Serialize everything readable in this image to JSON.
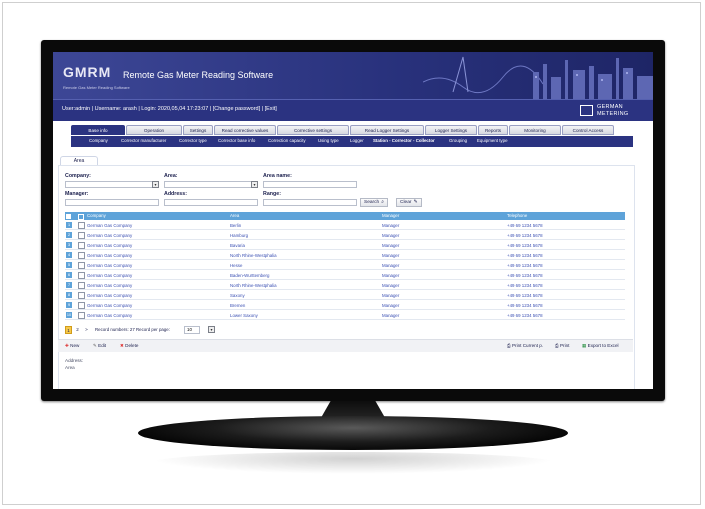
{
  "app": {
    "logo_text": "GMRM",
    "logo_subtitle": "Remote Gas Meter Reading Software",
    "title": "Remote Gas Meter Reading Software"
  },
  "userbar": {
    "text": "User:admin  |  Username: arash  |  Login: 2020,05,04  17:23:07  |  [Change password]  |  [Exit]",
    "brand_line1": "GERMAN",
    "brand_line2": "METERING"
  },
  "nav": {
    "tabs": [
      "Base info",
      "Operation",
      "Settings",
      "Read corrective values",
      "Corrective settings",
      "Read Logger Settings",
      "Logger Settings",
      "Reports",
      "Monitoring",
      "Control Access"
    ],
    "active": "Base info"
  },
  "subnav": {
    "items": [
      "Company",
      "Corrector manufacturer",
      "Corrector type",
      "Corrector base info",
      "Correction capacity",
      "Using type",
      "Logger",
      "Station - Corrector - Collector",
      "Grouping",
      "Equipment type"
    ],
    "active": "Station - Corrector - Collector"
  },
  "area_tab": "Area",
  "filters": {
    "company_label": "Company:",
    "area_label": "Area:",
    "area_name_label": "Area name:",
    "manager_label": "Manager:",
    "address_label": "Address:",
    "range_label": "Range:",
    "search_label": "Search",
    "clear_label": "Clear"
  },
  "table": {
    "columns": [
      "Company",
      "Area",
      "Manager",
      "Telephone"
    ],
    "rows": [
      {
        "num": "1",
        "company": "German Gas Company",
        "area": "Berlin",
        "manager": "Manager",
        "phone": "+49 69 1234 5678"
      },
      {
        "num": "2",
        "company": "German Gas Company",
        "area": "Hamburg",
        "manager": "Manager",
        "phone": "+49 69 1234 5678"
      },
      {
        "num": "3",
        "company": "German Gas Company",
        "area": "Bavaria",
        "manager": "Manager",
        "phone": "+49 69 1234 5678"
      },
      {
        "num": "4",
        "company": "German Gas Company",
        "area": "North Rhine-Westphalia",
        "manager": "Manager",
        "phone": "+49 69 1234 5678"
      },
      {
        "num": "5",
        "company": "German Gas Company",
        "area": "Hesse",
        "manager": "Manager",
        "phone": "+49 69 1234 5678"
      },
      {
        "num": "6",
        "company": "German Gas Company",
        "area": "Baden-Wurttemberg",
        "manager": "Manager",
        "phone": "+49 69 1234 5678"
      },
      {
        "num": "7",
        "company": "German Gas Company",
        "area": "North Rhine-Westphalia",
        "manager": "Manager",
        "phone": "+49 69 1234 5678"
      },
      {
        "num": "8",
        "company": "German Gas Company",
        "area": "Saxony",
        "manager": "Manager",
        "phone": "+49 69 1234 5678"
      },
      {
        "num": "9",
        "company": "German Gas Company",
        "area": "Bremen",
        "manager": "Manager",
        "phone": "+49 69 1234 5678"
      },
      {
        "num": "10",
        "company": "German Gas Company",
        "area": "Lower Saxony",
        "manager": "Manager",
        "phone": "+49 69 1234 5678"
      }
    ]
  },
  "pager": {
    "pages": [
      "1",
      "2"
    ],
    "next": ">",
    "info": "Record numbers: 27  Record per page:",
    "per_page": "10"
  },
  "actions": {
    "new": "New",
    "edit": "Edit",
    "delete": "Delete",
    "print_current": "Print Current p.",
    "print": "Print",
    "export": "Export to Excel"
  },
  "footer": {
    "address_label": "Address:",
    "area_label": "Area"
  },
  "colors": {
    "banner": "#2b3381",
    "table_header": "#5ea3d9",
    "link": "#3a4fb3",
    "logo_accent": "#e0294a"
  }
}
